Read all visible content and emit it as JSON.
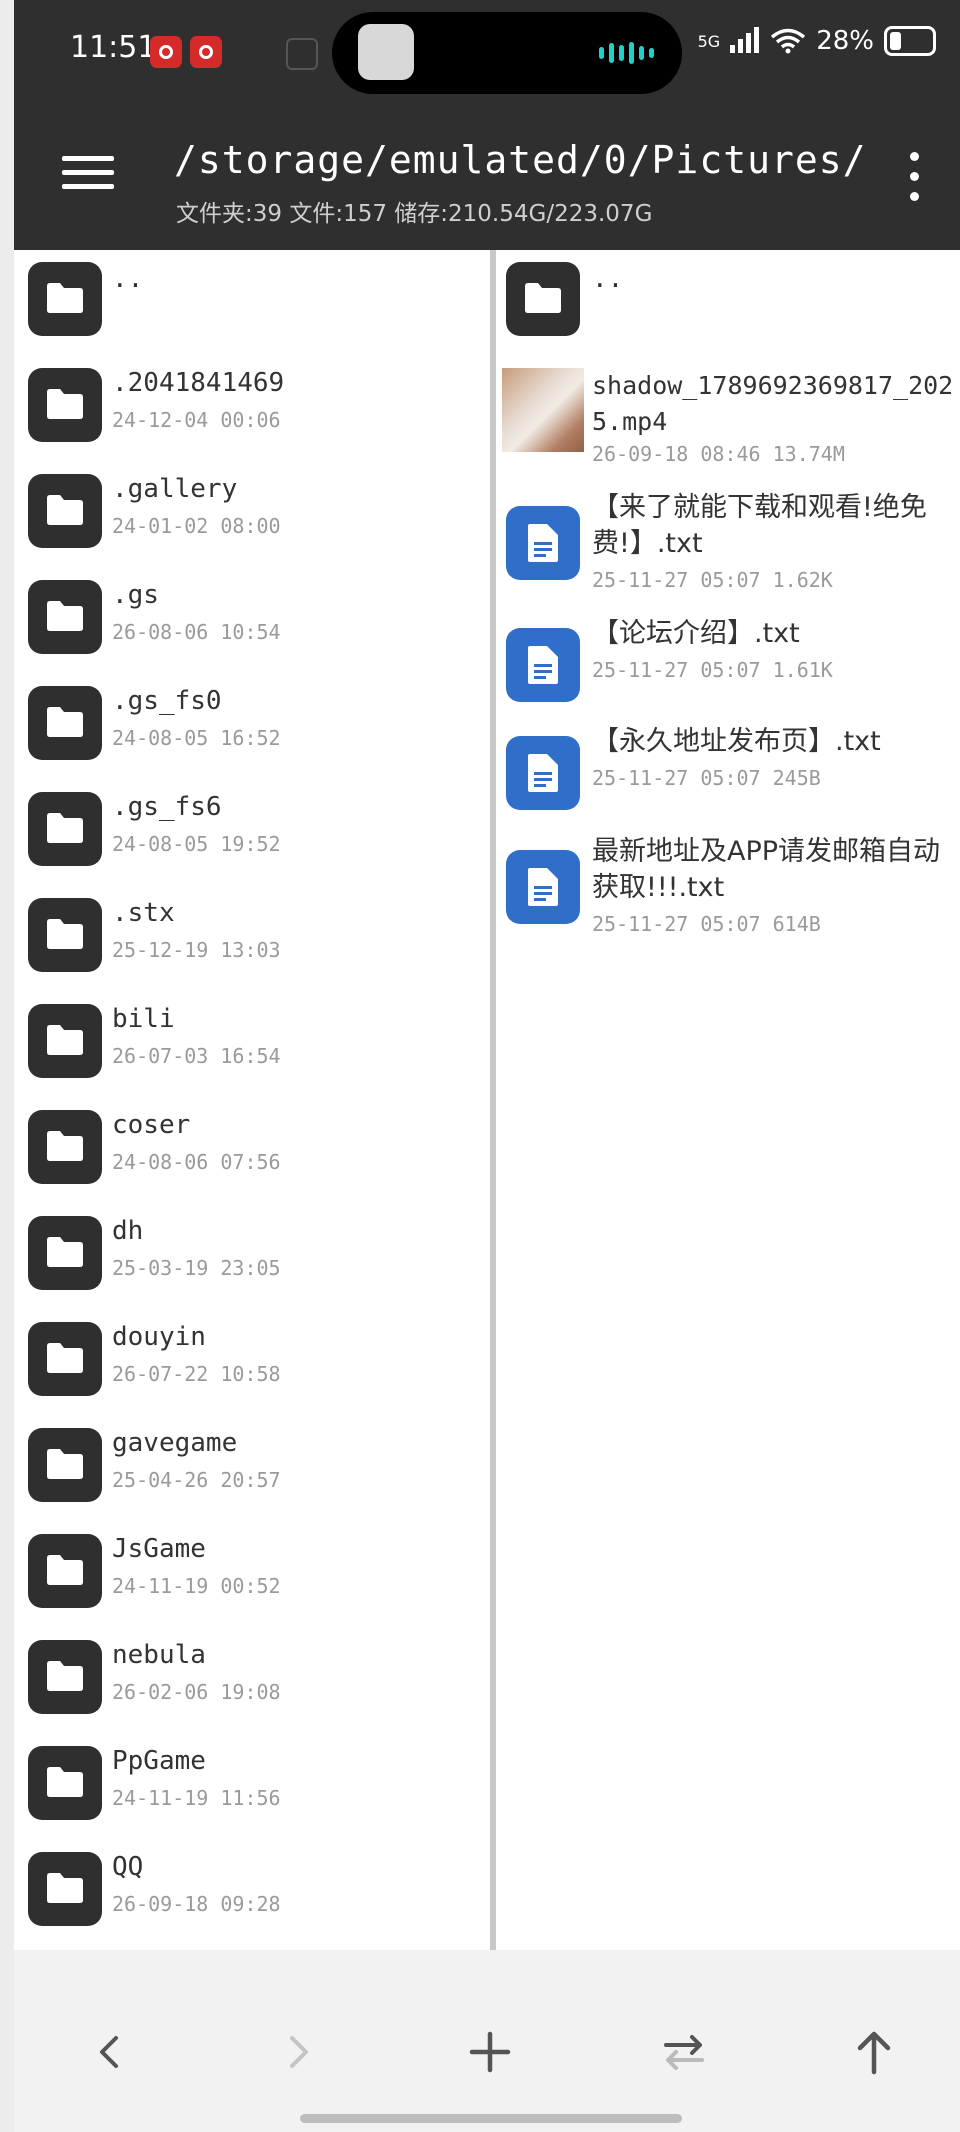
{
  "status": {
    "time": "11:51",
    "network": "5G",
    "battery_text": "28%",
    "battery_level": 0.28
  },
  "header": {
    "path": "/storage/emulated/0/Pictures/",
    "info": "文件夹:39 文件:157 储存:210.54G/223.07G"
  },
  "left_pane": {
    "parent": "..",
    "items": [
      {
        "name": ".2041841469",
        "date": "24-12-04 00:06"
      },
      {
        "name": ".gallery",
        "date": "24-01-02 08:00"
      },
      {
        "name": ".gs",
        "date": "26-08-06 10:54"
      },
      {
        "name": ".gs_fs0",
        "date": "24-08-05 16:52"
      },
      {
        "name": ".gs_fs6",
        "date": "24-08-05 19:52"
      },
      {
        "name": ".stx",
        "date": "25-12-19 13:03"
      },
      {
        "name": "bili",
        "date": "26-07-03 16:54"
      },
      {
        "name": "coser",
        "date": "24-08-06 07:56"
      },
      {
        "name": "dh",
        "date": "25-03-19 23:05"
      },
      {
        "name": "douyin",
        "date": "26-07-22 10:58"
      },
      {
        "name": "gavegame",
        "date": "25-04-26 20:57"
      },
      {
        "name": "JsGame",
        "date": "24-11-19 00:52"
      },
      {
        "name": "nebula",
        "date": "26-02-06 19:08"
      },
      {
        "name": "PpGame",
        "date": "24-11-19 11:56"
      },
      {
        "name": "QQ",
        "date": "26-09-18 09:28"
      }
    ]
  },
  "right_pane": {
    "parent": "..",
    "video": {
      "name": "shadow_1789692369817_2025.mp4",
      "meta": "26-09-18 08:46  13.74M"
    },
    "files": [
      {
        "name": "【来了就能下载和观看!绝免费!】.txt",
        "meta": "25-11-27 05:07  1.62K"
      },
      {
        "name": "【论坛介绍】.txt",
        "meta": "25-11-27 05:07  1.61K"
      },
      {
        "name": "【永久地址发布页】.txt",
        "meta": "25-11-27 05:07  245B"
      },
      {
        "name": "最新地址及APP请发邮箱自动获取!!!.txt",
        "meta": "25-11-27 05:07  614B"
      }
    ]
  }
}
